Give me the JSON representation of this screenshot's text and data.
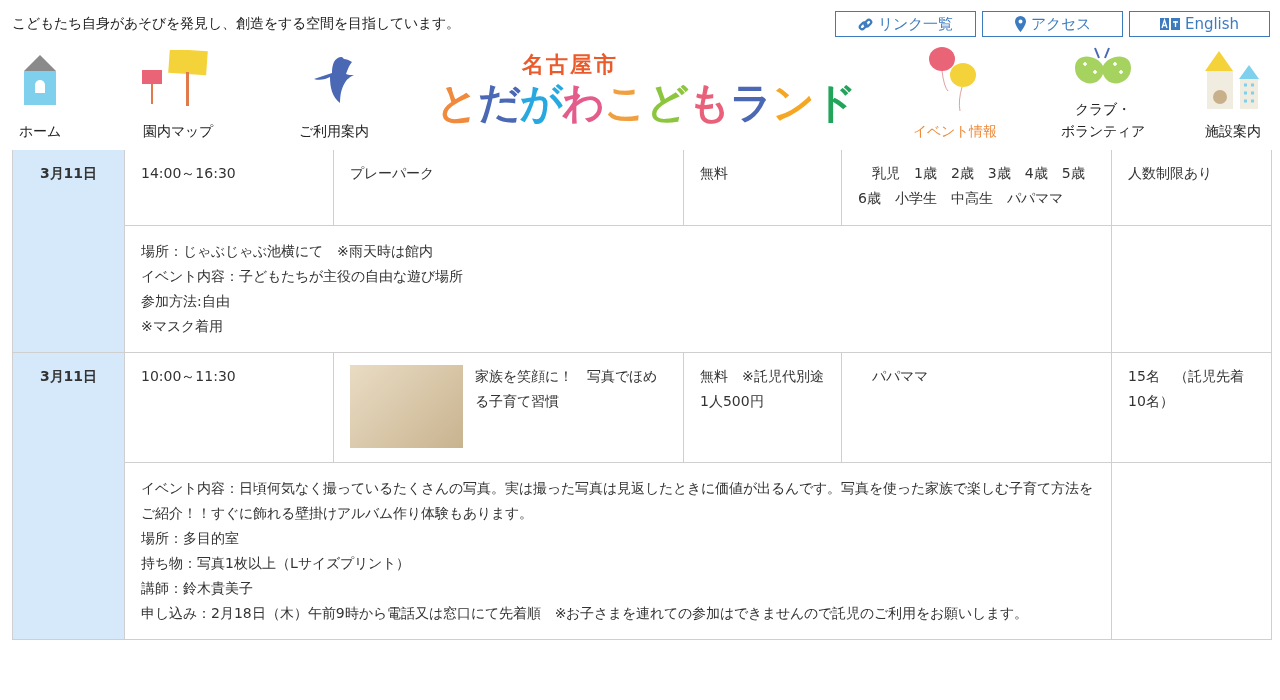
{
  "tagline": "こどもたち自身があそびを発見し、創造をする空間を目指しています。",
  "top_links": [
    {
      "label": "リンク一覧"
    },
    {
      "label": "アクセス"
    },
    {
      "label": "English"
    }
  ],
  "logo": {
    "city": "名古屋市",
    "name": "とだがわこどもランド"
  },
  "nav": [
    {
      "lines": [
        "ホーム"
      ],
      "selected": false
    },
    {
      "lines": [
        "園内マップ"
      ],
      "selected": false
    },
    {
      "lines": [
        "ご利用案内"
      ],
      "selected": false
    },
    {
      "lines": [
        "イベント情報"
      ],
      "selected": true
    },
    {
      "lines": [
        "クラブ・",
        "ボランティア"
      ],
      "selected": false
    },
    {
      "lines": [
        "施設案内"
      ],
      "selected": false
    }
  ],
  "events": [
    {
      "date": "3月11日",
      "time": "14:00～16:30",
      "title": "プレーパーク",
      "fee": "無料",
      "target": "　乳児　1歳　2歳　3歳　4歳　5歳　6歳　小学生　中高生　パパママ",
      "capacity": "人数制限あり",
      "photo": false,
      "details": [
        "場所：じゃぶじゃぶ池横にて　※雨天時は館内",
        "イベント内容：子どもたちが主役の自由な遊び場所",
        "参加方法:自由",
        "※マスク着用"
      ]
    },
    {
      "date": "3月11日",
      "time": "10:00～11:30",
      "title": "家族を笑顔に！　写真でほめる子育て習慣",
      "fee": "無料　※託児代別途　1人500円",
      "target": "　パパママ",
      "capacity": "15名　（託児先着10名）",
      "photo": true,
      "details": [
        "イベント内容：日頃何気なく撮っているたくさんの写真。実は撮った写真は見返したときに価値が出るんです。写真を使った家族で楽しむ子育て方法をご紹介！！すぐに飾れる壁掛けアルバム作り体験もあります。",
        "場所：多目的室",
        "持ち物：写真1枚以上（Lサイズプリント）",
        "講師：鈴木貴美子",
        "申し込み：2月18日（木）午前9時から電話又は窓口にて先着順　※お子さまを連れての参加はできませんので託児のご利用をお願いします。"
      ]
    }
  ]
}
